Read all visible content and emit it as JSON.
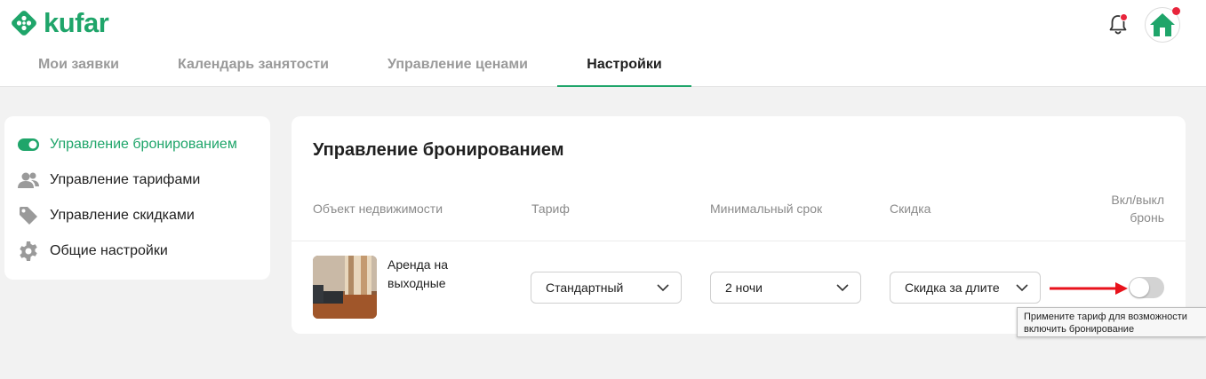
{
  "brand": {
    "name": "kufar",
    "color": "#1fa56a"
  },
  "header": {
    "icons": [
      "notification-bell-icon",
      "home-icon"
    ],
    "notification_dot_color": "#e8243b"
  },
  "tabs": [
    {
      "label": "Мои заявки",
      "active": false
    },
    {
      "label": "Календарь занятости",
      "active": false
    },
    {
      "label": "Управление ценами",
      "active": false
    },
    {
      "label": "Настройки",
      "active": true
    }
  ],
  "sidebar": {
    "items": [
      {
        "label": "Управление бронированием",
        "icon": "toggle-icon",
        "active": true
      },
      {
        "label": "Управление тарифами",
        "icon": "users-icon",
        "active": false
      },
      {
        "label": "Управление скидками",
        "icon": "tag-icon",
        "active": false
      },
      {
        "label": "Общие настройки",
        "icon": "gear-icon",
        "active": false
      }
    ]
  },
  "main": {
    "title": "Управление бронированием",
    "columns": {
      "object": "Объект недвижимости",
      "tariff": "Тариф",
      "min_term": "Минимальный срок",
      "discount": "Скидка",
      "toggle_line1": "Вкл/выкл",
      "toggle_line2": "бронь"
    },
    "rows": [
      {
        "name_line1": "Аренда на",
        "name_line2": "выходные",
        "tariff": "Стандартный",
        "min_term": "2 ночи",
        "discount": "Скидка за длите",
        "booking_enabled": false
      }
    ]
  },
  "tooltip": {
    "line1": "Примените тариф для возможности",
    "line2": "включить бронирование"
  },
  "annotation_arrow_color": "#e8121b"
}
